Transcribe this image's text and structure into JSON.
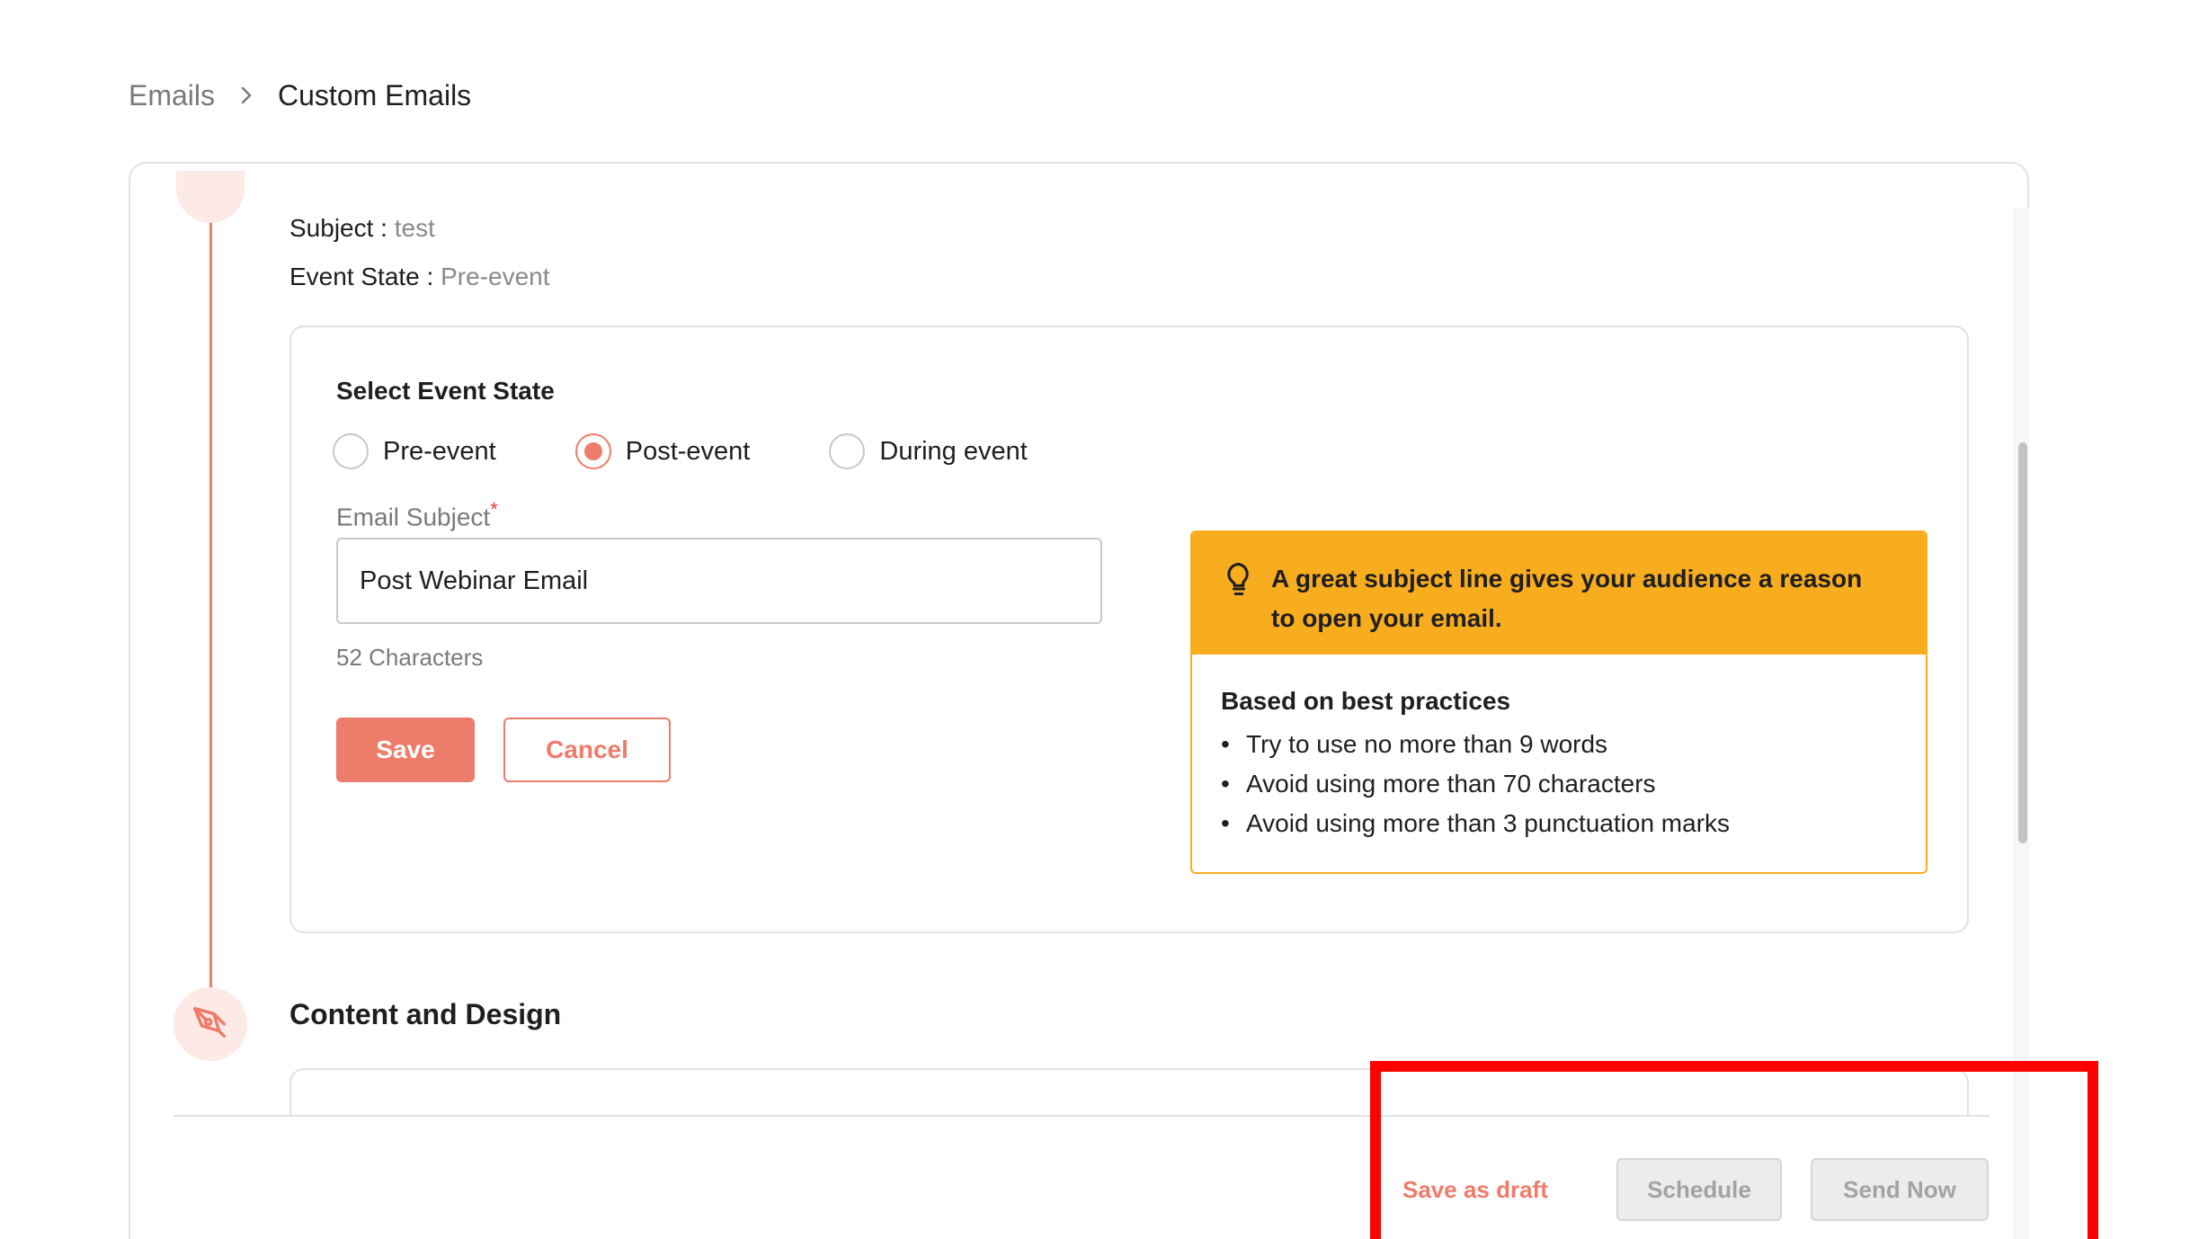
{
  "breadcrumb": {
    "parent": "Emails",
    "current": "Custom Emails",
    "separator_icon": "chevron-right-icon"
  },
  "summary": {
    "subject_label": "Subject : ",
    "subject_value": "test",
    "event_state_label": "Event State : ",
    "event_state_value": "Pre-event"
  },
  "form": {
    "section_title": "Select Event State",
    "event_states": [
      {
        "label": "Pre-event",
        "checked": false
      },
      {
        "label": "Post-event",
        "checked": true
      },
      {
        "label": "During event",
        "checked": false
      }
    ],
    "subject_label": "Email Subject",
    "required_mark": "*",
    "subject_value": "Post Webinar Email",
    "char_count": "52 Characters",
    "save_label": "Save",
    "cancel_label": "Cancel"
  },
  "tip": {
    "icon": "lightbulb-icon",
    "title": "A great subject line gives your audience a reason to open your email.",
    "subtitle": "Based on best practices",
    "items": [
      "Try to use no more than 9 words",
      "Avoid using more than 70 characters",
      "Avoid using more than 3 punctuation marks"
    ]
  },
  "next_section": {
    "icon": "pen-tool-icon",
    "title": "Content and Design"
  },
  "footer": {
    "draft_label": "Save as draft",
    "schedule_label": "Schedule",
    "send_label": "Send Now"
  },
  "colors": {
    "accent": "#ee7c6b",
    "tip_header": "#f8ad1f",
    "highlight": "#ff0000",
    "disabled_bg": "#ececec"
  }
}
